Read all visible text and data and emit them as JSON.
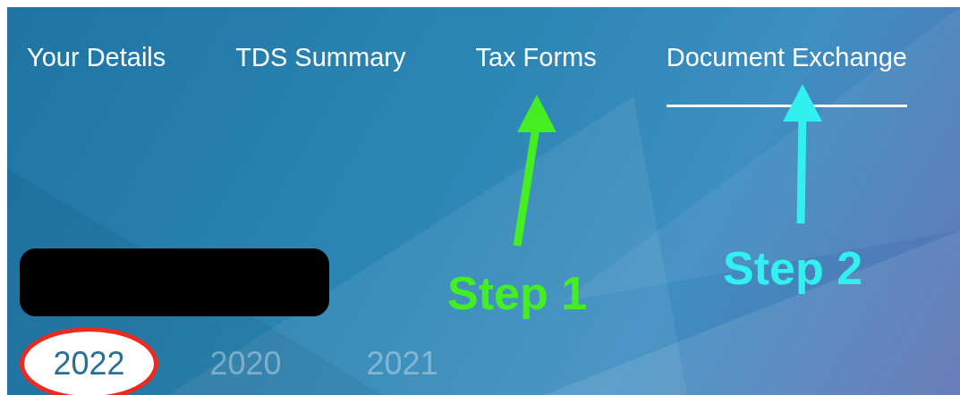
{
  "tabs": [
    {
      "label": "Your Details",
      "selected": false
    },
    {
      "label": "TDS Summary",
      "selected": false
    },
    {
      "label": "Tax Forms",
      "selected": false
    },
    {
      "label": "Document Exchange",
      "selected": true
    }
  ],
  "years": [
    {
      "label": "2022",
      "selected": true,
      "circled": true
    },
    {
      "label": "2020",
      "selected": false,
      "circled": false
    },
    {
      "label": "2021",
      "selected": false,
      "circled": false
    }
  ],
  "annotations": [
    {
      "label": "Step 1",
      "color": "#44ee22"
    },
    {
      "label": "Step 2",
      "color": "#33f0f0"
    }
  ]
}
